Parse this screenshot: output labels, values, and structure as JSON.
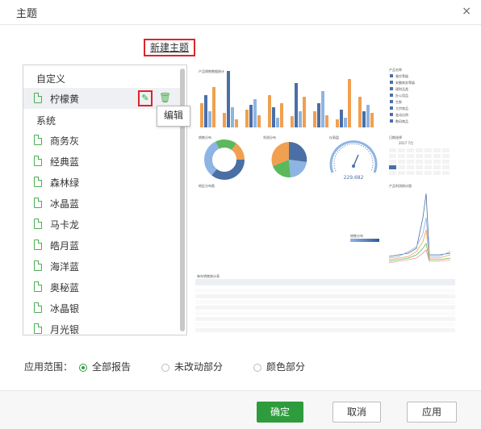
{
  "dialog": {
    "title": "主题",
    "close": "×"
  },
  "new_theme_label": "新建主题",
  "theme_list": {
    "custom_group": "自定义",
    "custom_items": [
      "柠檬黄"
    ],
    "system_group": "系统",
    "system_items": [
      "商务灰",
      "经典蓝",
      "森林绿",
      "冰晶蓝",
      "马卡龙",
      "皓月蓝",
      "海洋蓝",
      "奥秘蓝",
      "冰晶银",
      "月光银"
    ],
    "edit_tooltip": "编辑"
  },
  "preview": {
    "gauge_value": "229,682",
    "legend_items": [
      "餐饮等级",
      "安徽商务等级",
      "理财品类",
      "办公用品",
      "生鲜",
      "大宗商品",
      "变动比例",
      "数码商品"
    ],
    "calendar_month": "2017 7月",
    "colors": [
      "#f0a050",
      "#4a6fa5",
      "#8eb4e3",
      "#5cb85c",
      "#2e9c3d"
    ]
  },
  "scope": {
    "label": "应用范围：",
    "options": [
      {
        "label": "全部报告",
        "selected": true
      },
      {
        "label": "未改动部分",
        "selected": false
      },
      {
        "label": "颜色部分",
        "selected": false
      }
    ]
  },
  "buttons": {
    "ok": "确定",
    "cancel": "取消",
    "apply": "应用"
  }
}
